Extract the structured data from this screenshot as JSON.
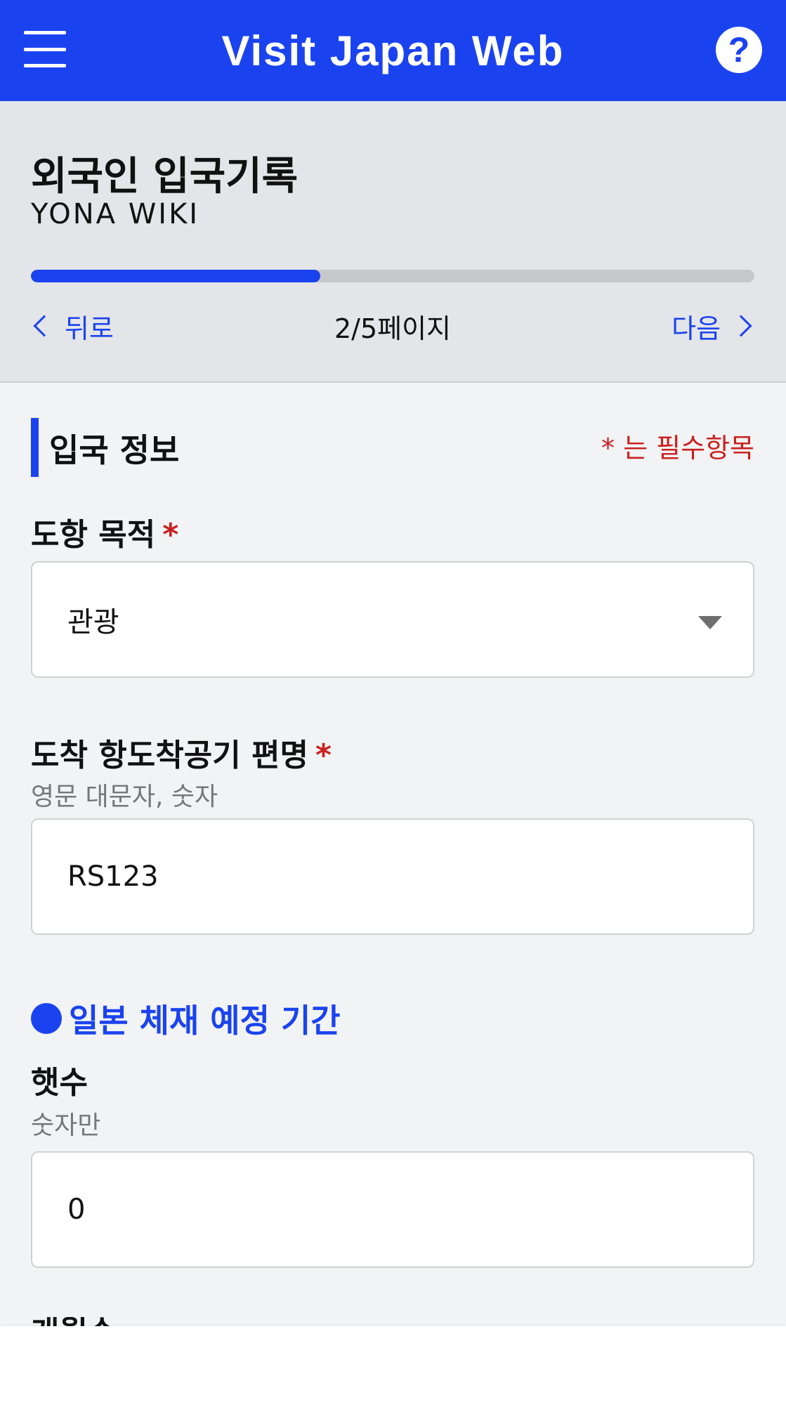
{
  "header": {
    "title": "Visit Japan Web",
    "help_glyph": "?"
  },
  "form": {
    "title": "외국인 입국기록",
    "subtitle": "YONA WIKI",
    "progress": {
      "current": 2,
      "total": 5,
      "fraction": 0.4
    },
    "nav": {
      "back_label": "뒤로",
      "page_indicator": "2/5페이지",
      "next_label": "다음"
    }
  },
  "section": {
    "title": "입국 정보",
    "required_note": "* 는 필수항목",
    "required_star": "*"
  },
  "fields": {
    "purpose": {
      "label": "도항 목적",
      "value": "관광"
    },
    "flight": {
      "label": "도착 항도착공기 편명",
      "hint": "영문 대문자, 숫자",
      "value": "RS123"
    },
    "stay_period": {
      "title": "일본 체재 예정 기간",
      "years": {
        "label": "햇수",
        "hint": "숫자만",
        "value": "0"
      },
      "next_label": "개월수"
    }
  },
  "colors": {
    "accent": "#1a43ef",
    "required": "#c9211e",
    "header_bg": "#e4e5e8",
    "body_bg": "#f2f3f5"
  },
  "icons": {
    "menu": "menu-icon",
    "help": "help-icon",
    "back": "chevron-left-icon",
    "next": "chevron-right-icon",
    "dropdown": "caret-down-icon",
    "bullet": "dot-icon"
  }
}
